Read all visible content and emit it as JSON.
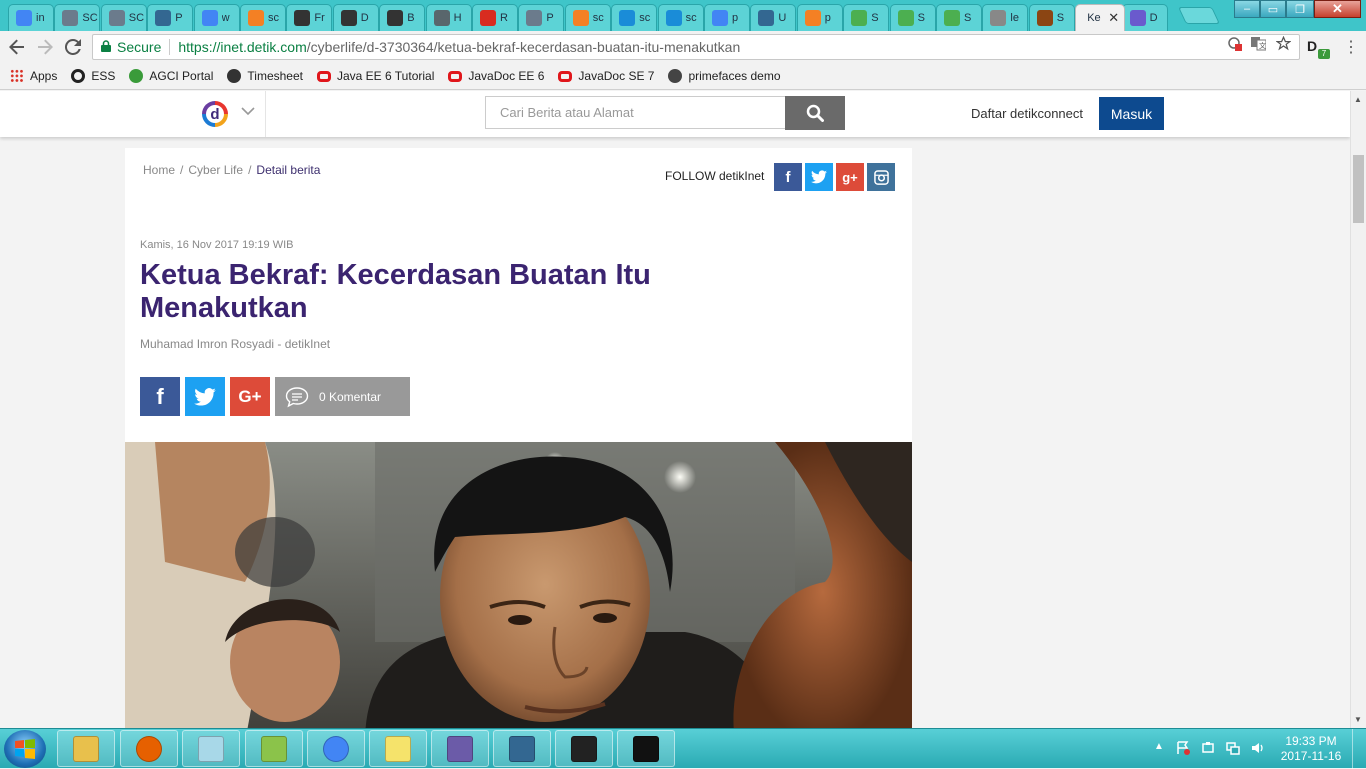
{
  "browser": {
    "tabs": [
      {
        "icon": "google-icon",
        "label": "in",
        "color": "#4285f4"
      },
      {
        "icon": "diamond-icon",
        "label": "SC",
        "color": "#6b7b8c"
      },
      {
        "icon": "diamond-icon",
        "label": "SC",
        "color": "#6b7b8c"
      },
      {
        "icon": "postgres-icon",
        "label": "P",
        "color": "#336791"
      },
      {
        "icon": "google-icon",
        "label": "w",
        "color": "#4285f4"
      },
      {
        "icon": "stack-icon",
        "label": "sc",
        "color": "#f48024"
      },
      {
        "icon": "wikipedia-icon",
        "label": "Fr",
        "color": "#333333"
      },
      {
        "icon": "wikipedia-icon",
        "label": "D",
        "color": "#333333"
      },
      {
        "icon": "wikipedia-icon",
        "label": "B",
        "color": "#333333"
      },
      {
        "icon": "hibernate-icon",
        "label": "H",
        "color": "#59666c"
      },
      {
        "icon": "redis-icon",
        "label": "R",
        "color": "#d82c20"
      },
      {
        "icon": "diamond-icon",
        "label": "P",
        "color": "#6b7b8c"
      },
      {
        "icon": "stack-icon",
        "label": "sc",
        "color": "#f48024"
      },
      {
        "icon": "db-icon",
        "label": "sc",
        "color": "#1a8cd8"
      },
      {
        "icon": "db-icon",
        "label": "sc",
        "color": "#1a8cd8"
      },
      {
        "icon": "google-icon",
        "label": "p",
        "color": "#4285f4"
      },
      {
        "icon": "postgres-icon",
        "label": "U",
        "color": "#336791"
      },
      {
        "icon": "stack-icon",
        "label": "p",
        "color": "#f48024"
      },
      {
        "icon": "w3-icon",
        "label": "S",
        "color": "#4caf50"
      },
      {
        "icon": "w3-icon",
        "label": "S",
        "color": "#4caf50"
      },
      {
        "icon": "w3-icon",
        "label": "S",
        "color": "#4caf50"
      },
      {
        "icon": "doc-icon",
        "label": "le",
        "color": "#888888"
      },
      {
        "icon": "coffee-icon",
        "label": "S",
        "color": "#8b4513"
      },
      {
        "icon": "none",
        "label": "Ke",
        "color": "#f2f2f2",
        "active": true
      },
      {
        "icon": "info-icon",
        "label": "D",
        "color": "#6a5acd"
      }
    ],
    "close_tab_glyph": "✕",
    "window_buttons": {
      "minimize": "–",
      "restore": "❐",
      "close": "✕"
    },
    "omnibox": {
      "secure_label": "Secure",
      "url_host": "https://inet.detik.com",
      "url_path": "/cyberlife/d-3730364/ketua-bekraf-kecerdasan-buatan-itu-menakutkan"
    },
    "extension_badge": "7",
    "bookmarks": [
      {
        "label": "Apps",
        "icon": "apps-grid-icon",
        "color": "#d93025"
      },
      {
        "label": "ESS",
        "icon": "circle-icon",
        "color": "#222222"
      },
      {
        "label": "AGCI Portal",
        "icon": "flower-icon",
        "color": "#3a9b3a"
      },
      {
        "label": "Timesheet",
        "icon": "timesheet-icon",
        "color": "#333333"
      },
      {
        "label": "Java EE 6 Tutorial",
        "icon": "oracle-icon",
        "color": "#e0161b"
      },
      {
        "label": "JavaDoc EE 6",
        "icon": "oracle-icon",
        "color": "#e0161b"
      },
      {
        "label": "JavaDoc SE 7",
        "icon": "oracle-icon",
        "color": "#e0161b"
      },
      {
        "label": "primefaces demo",
        "icon": "shield-icon",
        "color": "#444444"
      }
    ]
  },
  "site": {
    "logo_letter": "d",
    "search_placeholder": "Cari Berita atau Alamat",
    "register_label": "Daftar detikconnect",
    "login_label": "Masuk"
  },
  "article": {
    "breadcrumb": [
      "Home",
      "Cyber Life",
      "Detail berita"
    ],
    "follow_label": "FOLLOW detikInet",
    "date": "Kamis, 16 Nov 2017 19:19 WIB",
    "title": "Ketua Bekraf: Kecerdasan Buatan Itu Menakutkan",
    "author": "Muhamad Imron Rosyadi - detikInet",
    "comment_label": "0 Komentar",
    "social_colors": {
      "facebook": "#3b5998",
      "twitter": "#1da1f2",
      "googleplus": "#dd4b39",
      "instagram": "#3f729b"
    }
  },
  "taskbar": {
    "apps": [
      "file-explorer-icon",
      "firefox-icon",
      "notepad-icon",
      "notepadpp-icon",
      "chrome-icon",
      "sticky-notes-icon",
      "java-ee-ide-icon",
      "pgadmin-icon",
      "image-viewer-icon",
      "cmd-icon"
    ],
    "time": "19:33 PM",
    "date": "2017-11-16"
  }
}
